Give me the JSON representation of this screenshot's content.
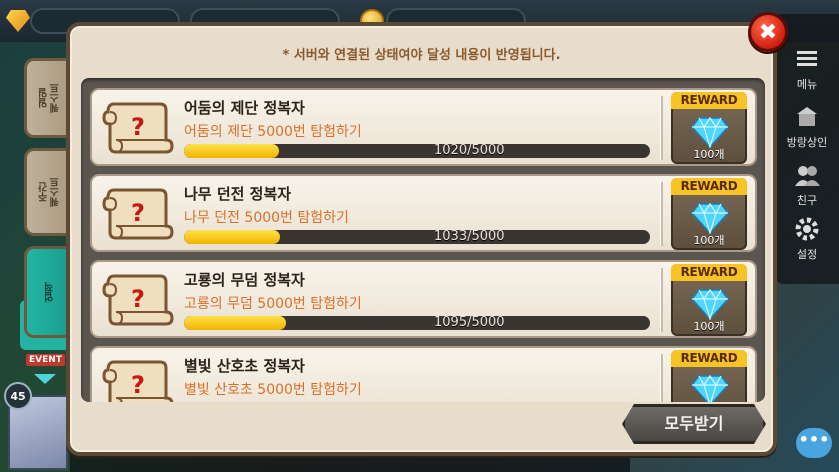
{
  "hud": {
    "right_nav": [
      {
        "label": "메뉴",
        "icon": "menu-icon"
      },
      {
        "label": "방랑상인",
        "icon": "shop-icon"
      },
      {
        "label": "친구",
        "icon": "friends-icon"
      },
      {
        "label": "설정",
        "icon": "gear-icon"
      }
    ],
    "level_badge": "45",
    "event_label": "EVENT",
    "chat_glyph": "•••"
  },
  "side_tabs": [
    {
      "label": "일일\n퀘스트",
      "active": false
    },
    {
      "label": "주간\n퀘스트",
      "active": false
    },
    {
      "label": "업적",
      "active": true
    }
  ],
  "panel": {
    "notice": "* 서버와 연결된 상태여야 달성 내용이 반영됩니다.",
    "claim_all_label": "모두받기",
    "close_glyph": "✖"
  },
  "quests": [
    {
      "title": "어둠의 제단 정복자",
      "desc": "어둠의 제단 5000번 탐험하기",
      "progress_text": "1020/5000",
      "current": 1020,
      "target": 5000,
      "reward_label": "REWARD",
      "reward_qty": "100개"
    },
    {
      "title": "나무 던전 정복자",
      "desc": "나무 던전 5000번 탐험하기",
      "progress_text": "1033/5000",
      "current": 1033,
      "target": 5000,
      "reward_label": "REWARD",
      "reward_qty": "100개"
    },
    {
      "title": "고룡의 무덤 정복자",
      "desc": "고룡의 무덤 5000번 탐험하기",
      "progress_text": "1095/5000",
      "current": 1095,
      "target": 5000,
      "reward_label": "REWARD",
      "reward_qty": "100개"
    },
    {
      "title": "별빛 산호초 정복자",
      "desc": "별빛 산호초 5000번 탐험하기",
      "progress_text": "",
      "current": 0,
      "target": 5000,
      "reward_label": "REWARD",
      "reward_qty": ""
    }
  ],
  "colors": {
    "panel_bg": "#e8dccb",
    "desc_orange": "#d9712a",
    "progress_fill": "#f2b300",
    "reward_yellow": "#f7c325",
    "diamond_blue": "#4fd6ff",
    "active_tab": "#22b6a4",
    "close_red": "#d11e10"
  }
}
